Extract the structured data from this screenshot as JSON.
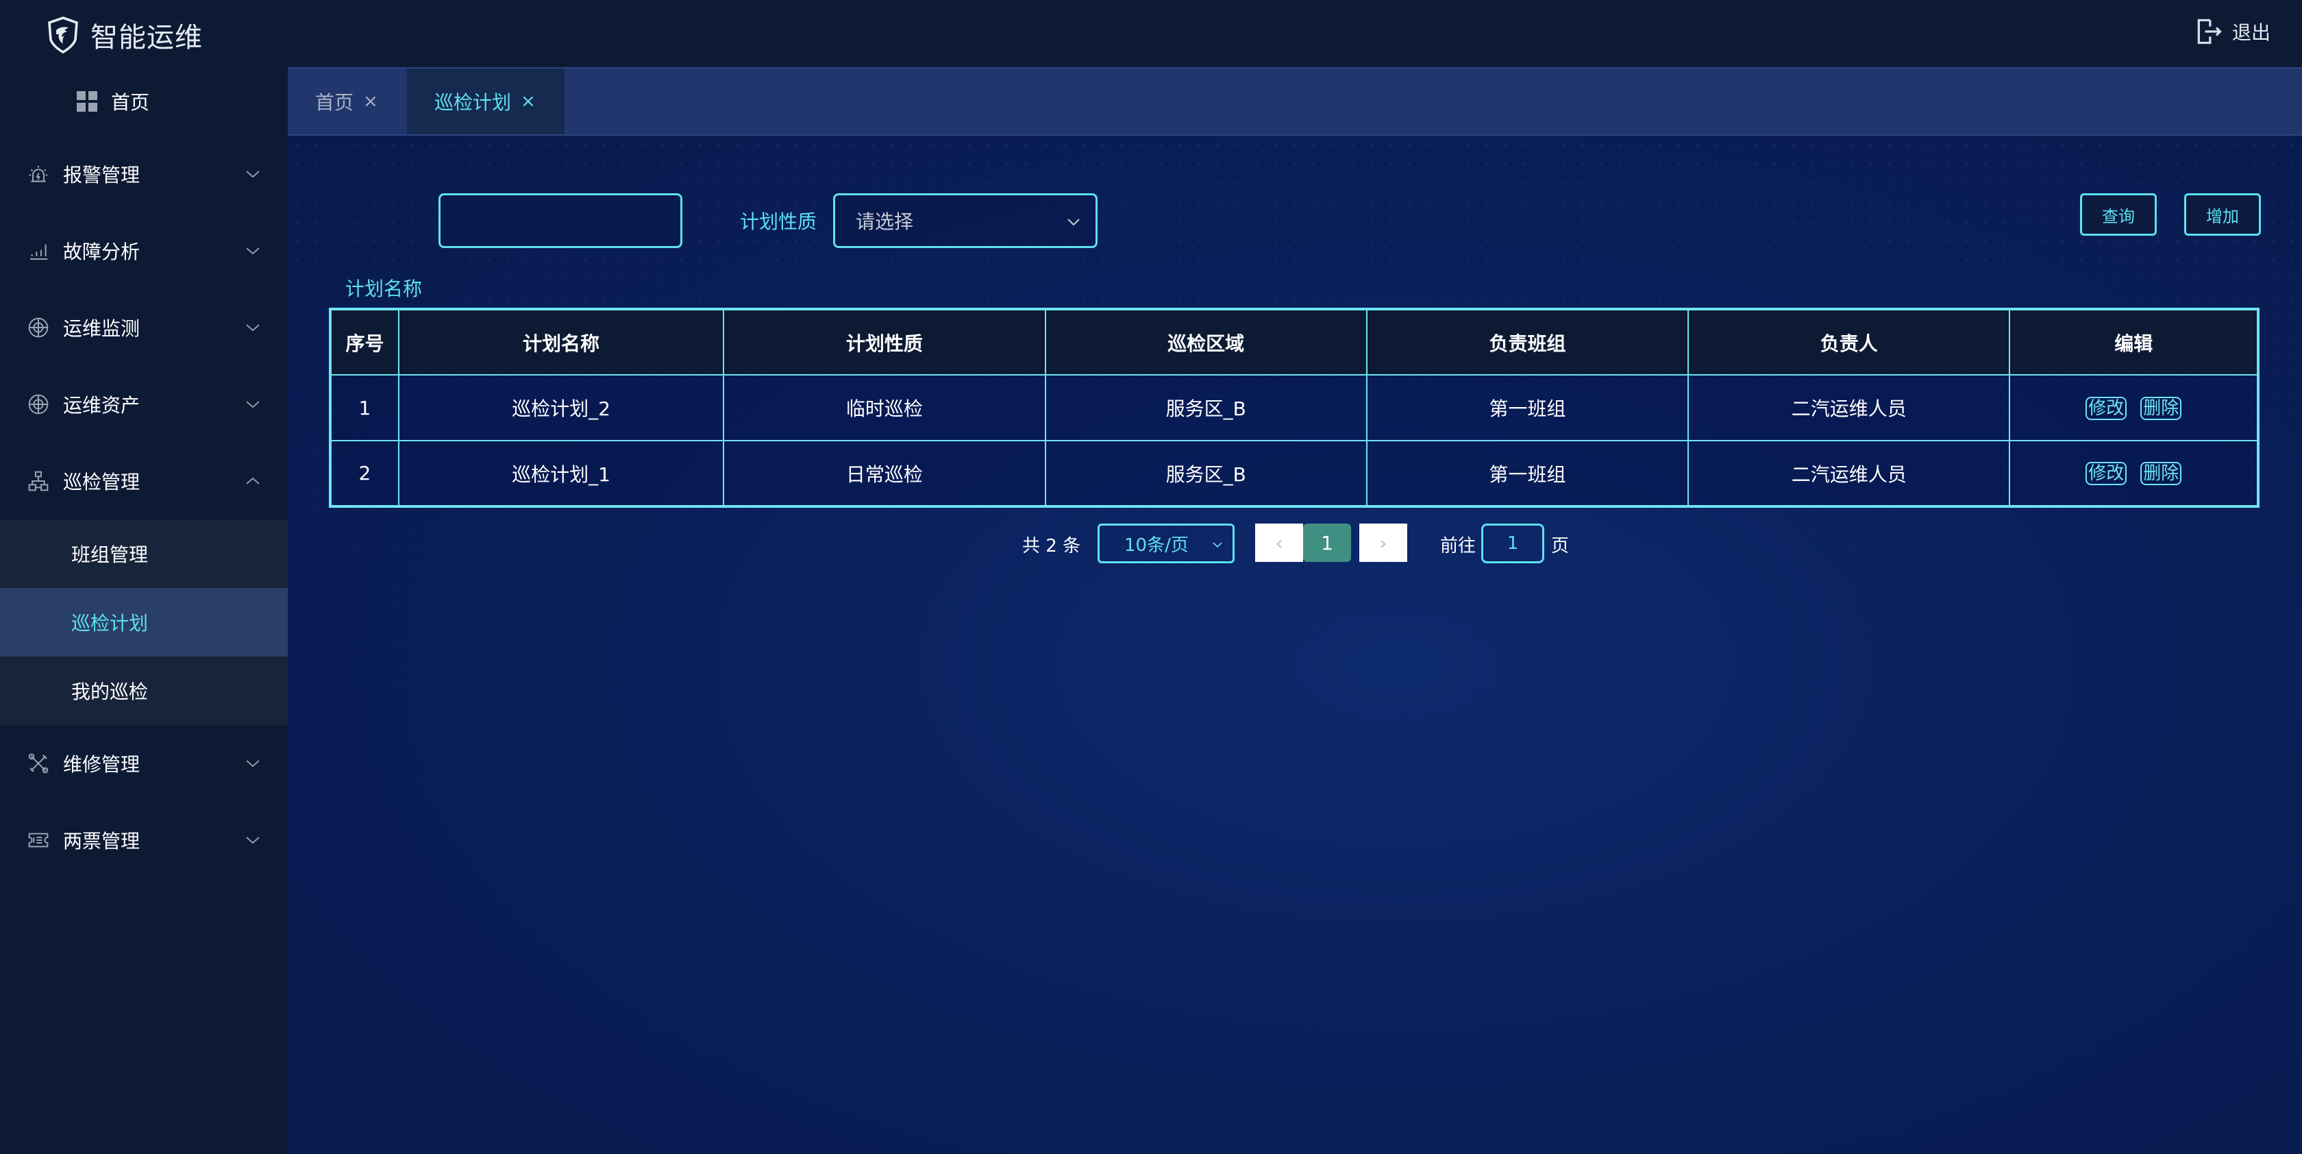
{
  "app": {
    "title": "智能运维",
    "logout_label": "退出"
  },
  "sidebar": {
    "home_label": "首页",
    "groups": [
      {
        "label": "报警管理",
        "icon": "alarm-light-icon",
        "expanded": false
      },
      {
        "label": "故障分析",
        "icon": "bar-chart-icon",
        "expanded": false
      },
      {
        "label": "运维监测",
        "icon": "target-icon",
        "expanded": false
      },
      {
        "label": "运维资产",
        "icon": "target-icon",
        "expanded": false
      },
      {
        "label": "巡检管理",
        "icon": "org-structure-icon",
        "expanded": true,
        "children": [
          {
            "label": "班组管理",
            "active": false
          },
          {
            "label": "巡检计划",
            "active": true
          },
          {
            "label": "我的巡检",
            "active": false
          }
        ]
      },
      {
        "label": "维修管理",
        "icon": "tools-icon",
        "expanded": false
      },
      {
        "label": "两票管理",
        "icon": "ticket-icon",
        "expanded": false
      }
    ]
  },
  "tabs": [
    {
      "label": "首页",
      "close": "×",
      "active": false
    },
    {
      "label": "巡检计划",
      "close": "×",
      "active": true
    }
  ],
  "search": {
    "name_label": "计划名称",
    "name_value": "",
    "name_placeholder": "",
    "type_label": "计划性质",
    "type_placeholder": "请选择",
    "query_button": "查询",
    "add_button": "增加"
  },
  "table": {
    "columns": [
      "序号",
      "计划名称",
      "计划性质",
      "巡检区域",
      "负责班组",
      "负责人",
      "编辑"
    ],
    "rows": [
      {
        "index": "1",
        "name": "巡检计划_2",
        "type": "临时巡检",
        "area": "服务区_B",
        "team": "第一班组",
        "owner": "二汽运维人员"
      },
      {
        "index": "2",
        "name": "巡检计划_1",
        "type": "日常巡检",
        "area": "服务区_B",
        "team": "第一班组",
        "owner": "二汽运维人员"
      }
    ],
    "edit_label": "修改",
    "delete_label": "删除"
  },
  "pagination": {
    "total_text": "共 2 条",
    "page_size": "10条/页",
    "prev": "‹",
    "current_page": "1",
    "next": "›",
    "goto_label": "前往",
    "goto_value": "1",
    "page_suffix": "页"
  },
  "colors": {
    "accent": "#5ee0f0",
    "header_bg": "#0c1a34",
    "active_menu_bg": "#2a3f66",
    "current_page_bg": "#3f8f82"
  }
}
